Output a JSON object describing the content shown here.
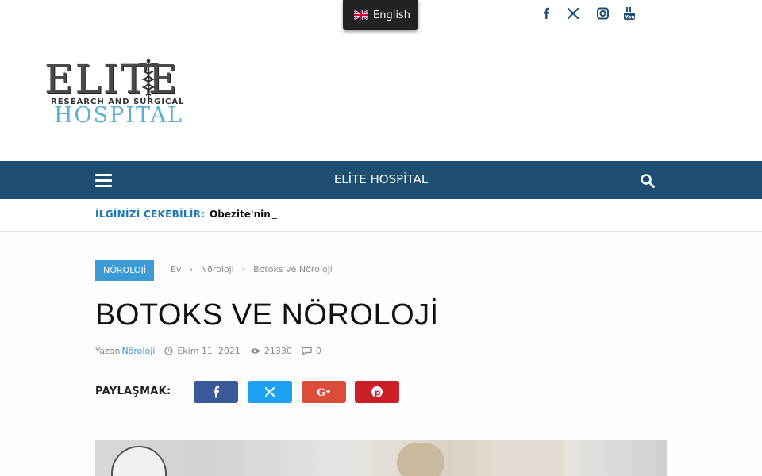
{
  "topbar": {
    "language_label": "English",
    "social_icons": [
      "facebook-icon",
      "x-twitter-icon",
      "instagram-icon",
      "youtube-icon"
    ]
  },
  "logo": {
    "line1": "ELITE",
    "line2": "RESEARCH AND SURGICAL",
    "line3": "HOSPITAL"
  },
  "nav": {
    "title": "ELİTE HOSPİTAL"
  },
  "ticker": {
    "label": "İLGİNİZİ ÇEKEBİLİR:",
    "headline": "Obezite'nin",
    "cursor": "_"
  },
  "article": {
    "category": "NÖROLOJİ",
    "breadcrumb": [
      "Ev",
      "Nöroloji",
      "Botoks ve Nöroloji"
    ],
    "title": "BOTOKS VE NÖROLOJİ",
    "author_prefix": "Yazan",
    "author": "Nöroloji",
    "date": "Ekim 11, 2021",
    "views": "21330",
    "comments": "0"
  },
  "share": {
    "label": "PAYLAŞMAK:",
    "buttons": [
      {
        "name": "facebook",
        "color": "#3b5998"
      },
      {
        "name": "x-twitter",
        "color": "#1da1f2"
      },
      {
        "name": "google-plus",
        "color": "#dd4b39"
      },
      {
        "name": "pinterest",
        "color": "#cb2027"
      }
    ]
  },
  "colors": {
    "brand_navy": "#1d4f73",
    "accent_blue": "#3a9bd6"
  }
}
